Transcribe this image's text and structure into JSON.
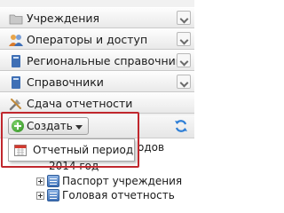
{
  "nav": {
    "items": [
      {
        "label": "Учреждения",
        "icon": "folder-icon"
      },
      {
        "label": "Операторы и доступ",
        "icon": "users-icon"
      },
      {
        "label": "Региональные справочники",
        "icon": "book-icon"
      },
      {
        "label": "Справочники",
        "icon": "book-icon"
      },
      {
        "label": "Сдача отчетности",
        "icon": "tools-icon"
      }
    ]
  },
  "toolbar": {
    "create_label": "Создать",
    "refresh_icon": "refresh-icon"
  },
  "dropdown": {
    "items": [
      {
        "label": "Отчетный период",
        "icon": "calendar-icon"
      }
    ]
  },
  "tree": {
    "peek_column": "одов",
    "year_node": "2014 год",
    "nodes": [
      {
        "label": "Паспорт учреждения"
      },
      {
        "label": "Головая отчетность"
      }
    ]
  },
  "colors": {
    "highlight": "#c0272d",
    "create_plus": "#2e8d20"
  }
}
